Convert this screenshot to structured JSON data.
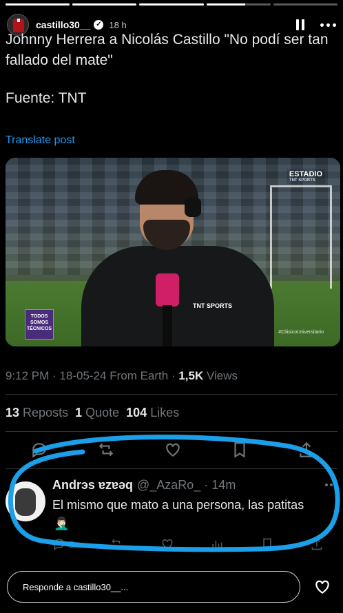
{
  "story": {
    "progress": [
      1,
      1,
      1,
      0.6,
      0
    ],
    "username": "castillo30__",
    "time": "18 h"
  },
  "post": {
    "text": "Johnny Herrera a Nicolás Castillo \"No podí ser tan fallado del mate\"",
    "source": "Fuente: TNT",
    "translate": "Translate post",
    "media": {
      "brand": "ESTADIO",
      "brand_sub": "TNT SPORTS",
      "badge": "TODOS SOMOS TÉCNICOS",
      "mic_label": "TNT SPORTS",
      "hashtag": "#ClásicoUniversitario"
    },
    "meta_time": "9:12 PM · 18-05-24 From Earth · ",
    "meta_views_count": "1,5K",
    "meta_views_label": " Views",
    "reposts_count": "13",
    "reposts_label": "Reposts",
    "quotes_count": "1",
    "quotes_label": "Quote",
    "likes_count": "104",
    "likes_label": "Likes"
  },
  "reply": {
    "name": "Andrэs ɐzɐəq",
    "handle": "@_AzaRo_ · 14m",
    "text": "El mismo que mato a una persona, las patitas",
    "emoji": "🤦🏻‍♂️",
    "replies": "2"
  },
  "composer": {
    "placeholder": "Responde a castillo30__..."
  },
  "colors": {
    "accent": "#1d9bf0",
    "annotation": "#1a9fe8",
    "background": "#000000"
  }
}
